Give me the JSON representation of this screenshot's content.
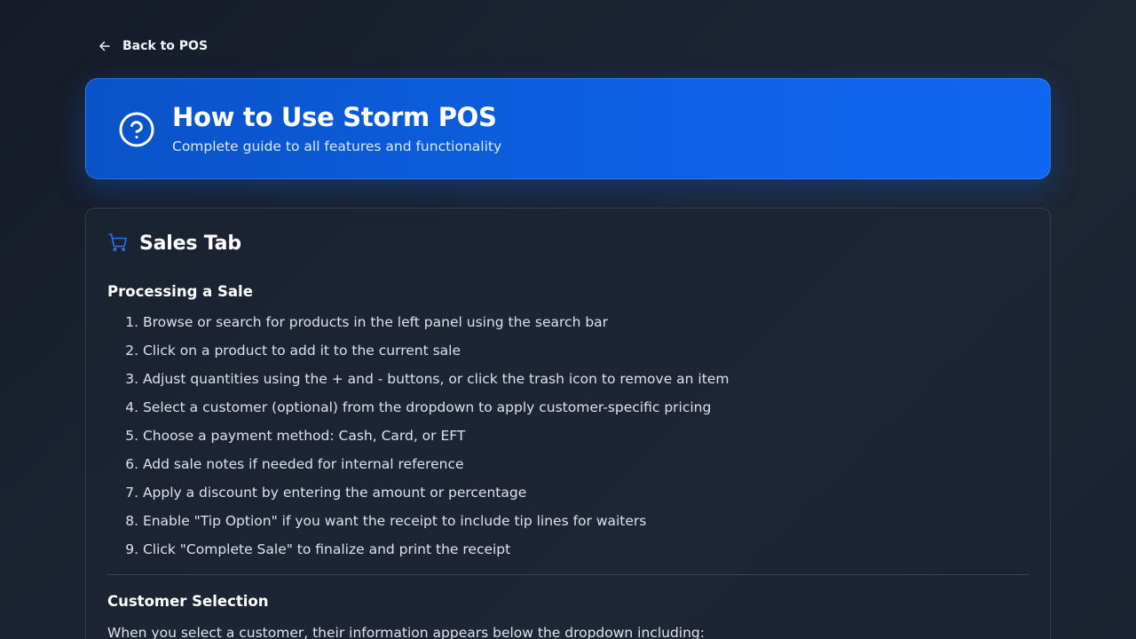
{
  "nav": {
    "back_label": "Back to POS",
    "back_icon": "arrow-left-icon"
  },
  "hero": {
    "icon": "help-circle-icon",
    "title": "How to Use Storm POS",
    "subtitle": "Complete guide to all features and functionality"
  },
  "sales_section": {
    "icon": "shopping-cart-icon",
    "title": "Sales Tab",
    "processing": {
      "title": "Processing a Sale",
      "steps": [
        {
          "num": "1.",
          "text": "Browse or search for products in the left panel using the search bar"
        },
        {
          "num": "2.",
          "text": "Click on a product to add it to the current sale"
        },
        {
          "num": "3.",
          "text": "Adjust quantities using the + and - buttons, or click the trash icon to remove an item"
        },
        {
          "num": "4.",
          "text": "Select a customer (optional) from the dropdown to apply customer-specific pricing"
        },
        {
          "num": "5.",
          "text": "Choose a payment method: Cash, Card, or EFT"
        },
        {
          "num": "6.",
          "text": "Add sale notes if needed for internal reference"
        },
        {
          "num": "7.",
          "text": "Apply a discount by entering the amount or percentage"
        },
        {
          "num": "8.",
          "text": "Enable \"Tip Option\" if you want the receipt to include tip lines for waiters"
        },
        {
          "num": "9.",
          "text": "Click \"Complete Sale\" to finalize and print the receipt"
        }
      ]
    },
    "customer_selection": {
      "title": "Customer Selection",
      "description": "When you select a customer, their information appears below the dropdown including:"
    }
  },
  "colors": {
    "accent": "#0d5fe0",
    "icon_blue": "#2f6fe8",
    "background": "#1c2433"
  }
}
